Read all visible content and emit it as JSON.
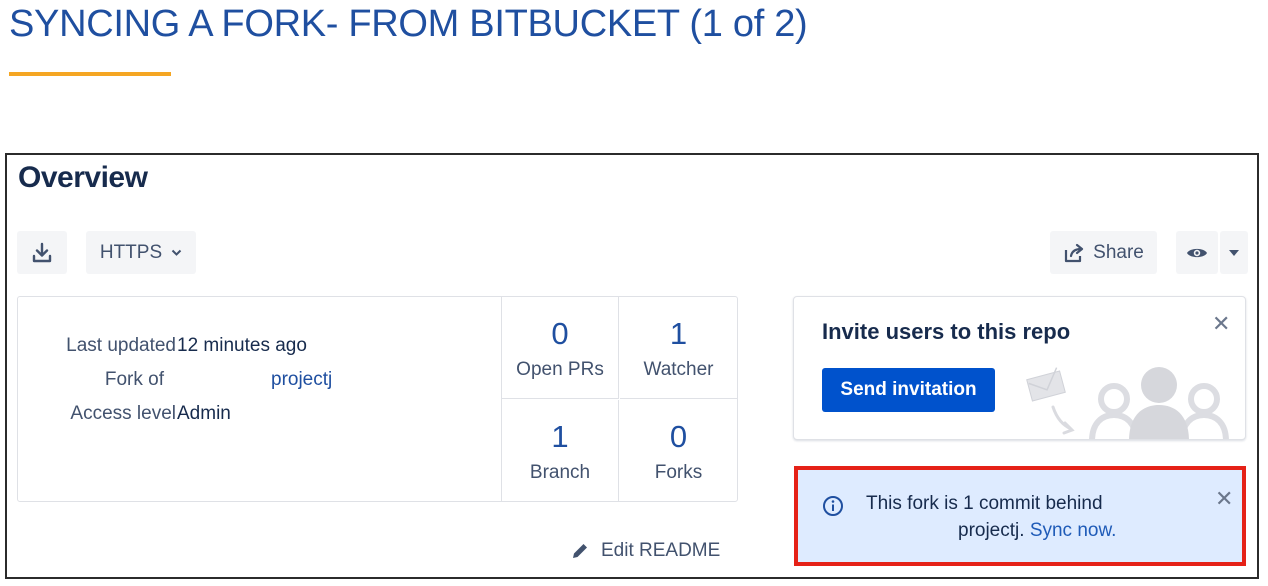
{
  "slide": {
    "title": "SYNCING A FORK- FROM BITBUCKET (1 of 2)",
    "accent_color": "#f5a623"
  },
  "overview": {
    "heading": "Overview",
    "toolbar": {
      "clone_icon": "download-icon",
      "protocol": "HTTPS",
      "share_label": "Share",
      "watch_icon": "eye-icon"
    },
    "info": {
      "last_updated_label": "Last updated",
      "last_updated_value": "12 minutes ago",
      "fork_of_label": "Fork of",
      "fork_of_value": "projectj",
      "access_label": "Access level",
      "access_value": "Admin"
    },
    "stats": [
      {
        "value": "0",
        "label": "Open PRs"
      },
      {
        "value": "1",
        "label": "Watcher"
      },
      {
        "value": "1",
        "label": "Branch"
      },
      {
        "value": "0",
        "label": "Forks"
      }
    ],
    "edit_readme": "Edit README"
  },
  "invite": {
    "title": "Invite users to this repo",
    "button": "Send invitation"
  },
  "sync": {
    "line1": "This fork is 1 commit behind",
    "repo": "projectj.",
    "link": "Sync now.",
    "highlight_color": "#e52117"
  }
}
